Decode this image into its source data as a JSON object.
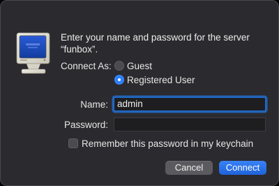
{
  "dialog": {
    "prompt": "Enter your name and password for the server “funbox”.",
    "server_icon": "crt-monitor-icon"
  },
  "connect_as": {
    "label": "Connect As:",
    "options": [
      {
        "label": "Guest",
        "selected": false
      },
      {
        "label": "Registered User",
        "selected": true
      }
    ]
  },
  "name_field": {
    "label": "Name:",
    "value": "admin"
  },
  "password_field": {
    "label": "Password:",
    "value": ""
  },
  "keychain": {
    "label": "Remember this password in my keychain",
    "checked": false
  },
  "buttons": {
    "cancel": "Cancel",
    "connect": "Connect"
  },
  "colors": {
    "accent": "#2d7ff9",
    "dialog_bg": "#2b2a2e"
  }
}
